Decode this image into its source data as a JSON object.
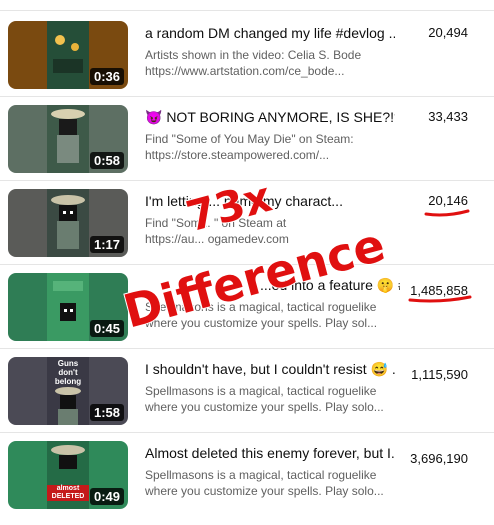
{
  "videos": [
    {
      "title": "a random DM changed my life #devlog ...",
      "desc1": "Artists shown in the video: Celia S. Bode",
      "desc2": "https://www.artstation.com/ce_bode...",
      "views": "20,494",
      "duration": "0:36",
      "thumb_color": "#7a4a10"
    },
    {
      "title": "😈 NOT BORING ANYMORE, IS SHE?!? #...",
      "desc1": "Find \"Some of You May Die\" on Steam:",
      "desc2": "https://store.steampowered.com/...",
      "views": "33,433",
      "duration": "0:58",
      "thumb_color": "#5d6f63"
    },
    {
      "title": "I'm letting ... name my charact...",
      "desc1": "Find \"Som... \" on Steam at",
      "desc2": "https://au... ogamedev.com",
      "views": "20,146",
      "duration": "1:17",
      "thumb_color": "#5a5b58"
    },
    {
      "title": "...ed into a feature 🤫 #...",
      "desc1": "Spellmasons is a magical, tactical roguelike",
      "desc2": "where you customize your spells. Play sol...",
      "views": "1,485,858",
      "duration": "0:45",
      "thumb_color": "#2f7d55"
    },
    {
      "title": "I shouldn't have, but I couldn't resist 😅 ...",
      "desc1": "Spellmasons is a magical, tactical roguelike",
      "desc2": "where you customize your spells. Play solo...",
      "views": "1,115,590",
      "duration": "1:58",
      "thumb_color": "#4b4a55",
      "thumb_text": "Guns don't belong"
    },
    {
      "title": "Almost deleted this enemy forever, but I...",
      "desc1": "Spellmasons is a magical, tactical roguelike",
      "desc2": "where you customize your spells. Play solo...",
      "views": "3,696,190",
      "duration": "0:49",
      "thumb_color": "#2f8a5a",
      "thumb_text": "almost DELETED"
    }
  ],
  "annotation": {
    "line1": "73x",
    "line2": "Difference",
    "color": "#e01010"
  }
}
